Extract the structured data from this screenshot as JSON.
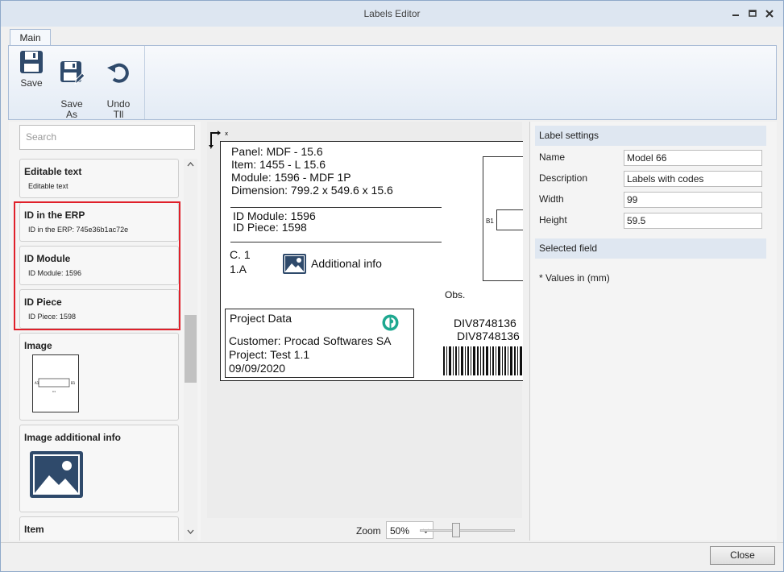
{
  "window": {
    "title": "Labels Editor"
  },
  "ribbon": {
    "tab": "Main",
    "buttons": {
      "save": "Save",
      "save_as": "Save\nAs",
      "undo": "Undo\nTll"
    }
  },
  "left_panel": {
    "search_placeholder": "Search",
    "cards": [
      {
        "title": "Editable text",
        "sub": "Editable text"
      },
      {
        "title": "ID in the ERP",
        "sub": "ID in the ERP: 745e36b1ac72e"
      },
      {
        "title": "ID Module",
        "sub": "ID Module: 1596"
      },
      {
        "title": "ID Piece",
        "sub": "ID Piece: 1598"
      },
      {
        "title": "Image",
        "sub": ""
      },
      {
        "title": "Image additional info",
        "sub": ""
      },
      {
        "title": "Item",
        "sub": ""
      }
    ],
    "thumb_labels": {
      "b1": "B1",
      "a1": "A1",
      "c1": "C1"
    }
  },
  "canvas": {
    "axis_x": "x",
    "axis_y": "Y",
    "lines": {
      "panel": "Panel: MDF - 15.6",
      "item": "Item: 1455 - L 15.6",
      "module": "Module: 1596 - MDF 1P",
      "dimension": "Dimension: 799.2 x 549.6 x 15.6",
      "id_module": "ID Module: 1596",
      "id_piece": "ID Piece: 1598",
      "c1": "C. 1",
      "one_a": "1.A",
      "additional_info": "Additional info",
      "obs": "Obs.",
      "b1": "B1",
      "project_data": "Project Data",
      "customer": "Customer: Procad Softwares SA",
      "project": "Project: Test 1.1",
      "date": "09/09/2020",
      "barcode1": "DIV8748136",
      "barcode2": "DIV8748136"
    },
    "zoom_label": "Zoom",
    "zoom_value": "50%"
  },
  "right_panel": {
    "label_settings": "Label settings",
    "fields": [
      {
        "label": "Name",
        "value": "Model 66"
      },
      {
        "label": "Description",
        "value": "Labels with codes"
      },
      {
        "label": "Width",
        "value": "99"
      },
      {
        "label": "Height",
        "value": "59.5"
      }
    ],
    "selected_field": "Selected field",
    "note": "* Values in (mm)"
  },
  "footer": {
    "close": "Close"
  },
  "colors": {
    "accent_icon": "#2f4a6b",
    "highlight": "#e0202a",
    "logo": "#1ea890"
  }
}
